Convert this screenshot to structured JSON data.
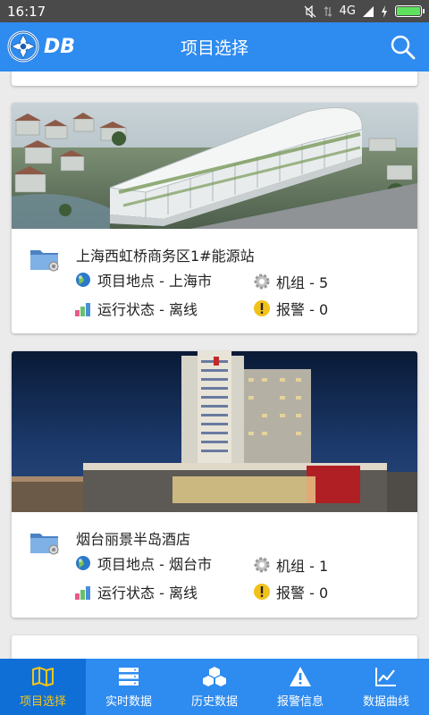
{
  "status_bar": {
    "time": "16:17",
    "network": "4G"
  },
  "app_bar": {
    "logo_text": "DB",
    "title": "项目选择"
  },
  "projects": [
    {
      "name": "上海西虹桥商务区1#能源站",
      "location": "项目地点 - 上海市",
      "units": "机组 - 5",
      "status": "运行状态 - 离线",
      "alarm": "报警 - 0"
    },
    {
      "name": "烟台丽景半岛酒店",
      "location": "项目地点 - 烟台市",
      "units": "机组 - 1",
      "status": "运行状态 - 离线",
      "alarm": "报警 - 0"
    }
  ],
  "bottom_nav": {
    "active_index": 0,
    "items": [
      {
        "label": "项目选择",
        "icon": "map-icon"
      },
      {
        "label": "实时数据",
        "icon": "server-icon"
      },
      {
        "label": "历史数据",
        "icon": "boxes-icon"
      },
      {
        "label": "报警信息",
        "icon": "warning-icon"
      },
      {
        "label": "数据曲线",
        "icon": "line-chart-icon"
      }
    ]
  },
  "colors": {
    "primary": "#2e8bef",
    "nav_active": "#0f6fd6",
    "status_bar": "#4a4a4a"
  }
}
